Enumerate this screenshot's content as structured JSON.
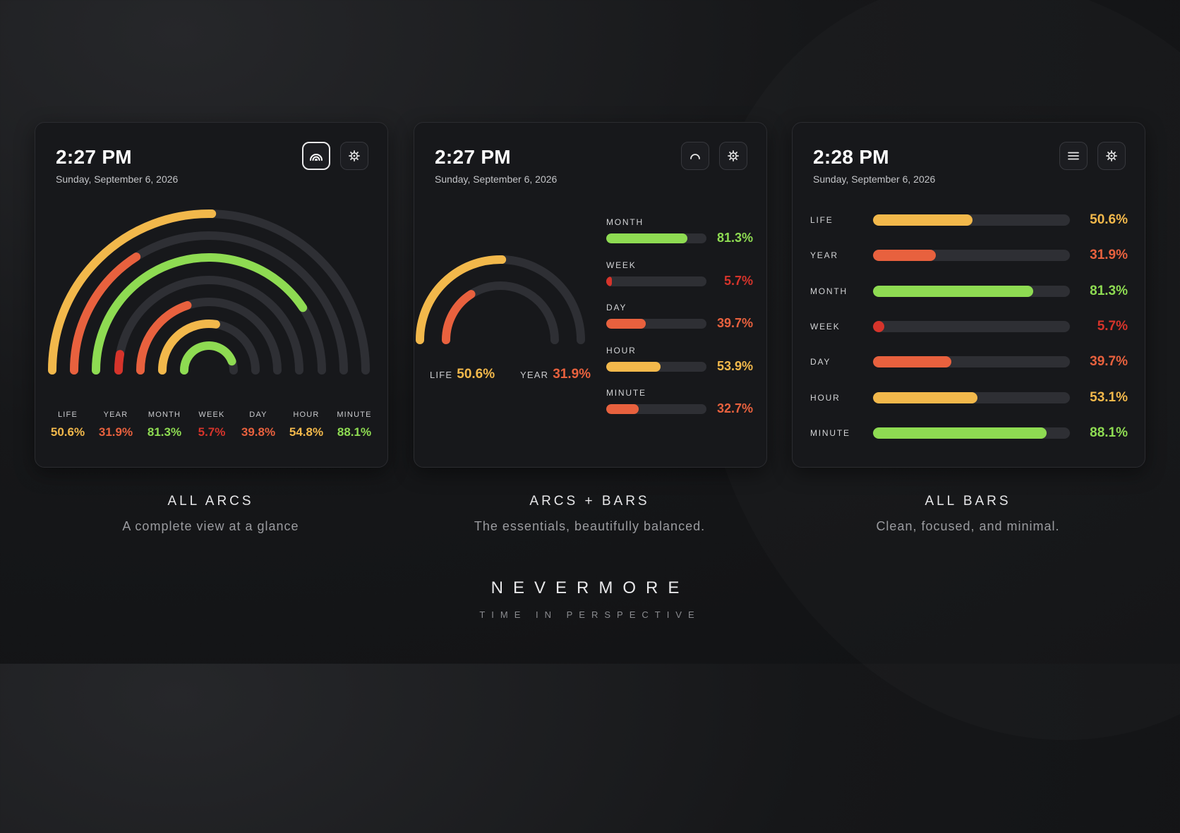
{
  "colors": {
    "yellow": "#f2b84b",
    "orange": "#e8613e",
    "green": "#8edb52",
    "red": "#d6342b",
    "track": "#2e2f34"
  },
  "cards": [
    {
      "time": "2:27 PM",
      "date": "Sunday, September 6, 2026",
      "view_icon": "rainbow-arcs-icon",
      "settings_icon": "gear-icon",
      "arcs": [
        {
          "label": "LIFE",
          "value": "50.6%",
          "fraction": 0.506,
          "color": "#f2b84b"
        },
        {
          "label": "YEAR",
          "value": "31.9%",
          "fraction": 0.319,
          "color": "#e8613e"
        },
        {
          "label": "MONTH",
          "value": "81.3%",
          "fraction": 0.813,
          "color": "#8edb52"
        },
        {
          "label": "WEEK",
          "value": "5.7%",
          "fraction": 0.057,
          "color": "#d6342b"
        },
        {
          "label": "DAY",
          "value": "39.8%",
          "fraction": 0.398,
          "color": "#e8613e"
        },
        {
          "label": "HOUR",
          "value": "54.8%",
          "fraction": 0.548,
          "color": "#f2b84b"
        },
        {
          "label": "MINUTE",
          "value": "88.1%",
          "fraction": 0.881,
          "color": "#8edb52"
        }
      ],
      "title": "ALL ARCS",
      "subtitle": "A complete view at a glance"
    },
    {
      "time": "2:27 PM",
      "date": "Sunday, September 6, 2026",
      "view_icon": "single-arc-icon",
      "settings_icon": "gear-icon",
      "arcs": [
        {
          "label": "LIFE",
          "value": "50.6%",
          "fraction": 0.506,
          "color": "#f2b84b"
        },
        {
          "label": "YEAR",
          "value": "31.9%",
          "fraction": 0.319,
          "color": "#e8613e"
        }
      ],
      "bars": [
        {
          "label": "MONTH",
          "value": "81.3%",
          "fraction": 0.813,
          "color": "#8edb52"
        },
        {
          "label": "WEEK",
          "value": "5.7%",
          "fraction": 0.057,
          "color": "#d6342b"
        },
        {
          "label": "DAY",
          "value": "39.7%",
          "fraction": 0.397,
          "color": "#e8613e"
        },
        {
          "label": "HOUR",
          "value": "53.9%",
          "fraction": 0.539,
          "color": "#f2b84b"
        },
        {
          "label": "MINUTE",
          "value": "32.7%",
          "fraction": 0.327,
          "color": "#e8613e"
        }
      ],
      "title": "ARCS + BARS",
      "subtitle": "The essentials, beautifully balanced."
    },
    {
      "time": "2:28 PM",
      "date": "Sunday, September 6, 2026",
      "view_icon": "list-icon",
      "settings_icon": "gear-icon",
      "bars": [
        {
          "label": "LIFE",
          "value": "50.6%",
          "fraction": 0.506,
          "color": "#f2b84b"
        },
        {
          "label": "YEAR",
          "value": "31.9%",
          "fraction": 0.319,
          "color": "#e8613e"
        },
        {
          "label": "MONTH",
          "value": "81.3%",
          "fraction": 0.813,
          "color": "#8edb52"
        },
        {
          "label": "WEEK",
          "value": "5.7%",
          "fraction": 0.057,
          "color": "#d6342b"
        },
        {
          "label": "DAY",
          "value": "39.7%",
          "fraction": 0.397,
          "color": "#e8613e"
        },
        {
          "label": "HOUR",
          "value": "53.1%",
          "fraction": 0.531,
          "color": "#f2b84b"
        },
        {
          "label": "MINUTE",
          "value": "88.1%",
          "fraction": 0.881,
          "color": "#8edb52"
        }
      ],
      "title": "ALL BARS",
      "subtitle": "Clean, focused, and minimal."
    }
  ],
  "brand": {
    "name": "NEVERMORE",
    "tagline": "TIME IN PERSPECTIVE"
  }
}
